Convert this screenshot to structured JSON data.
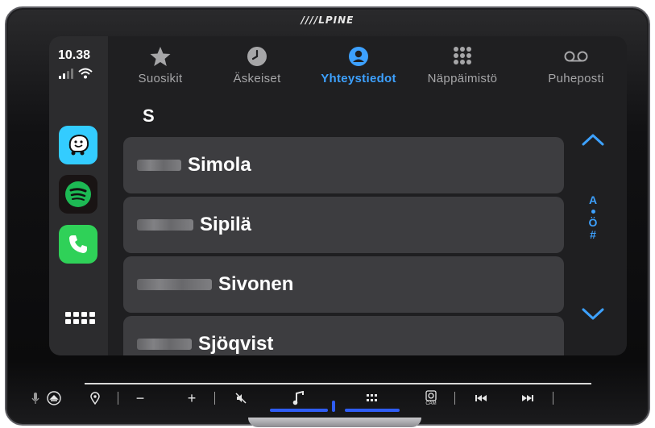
{
  "device": {
    "brand": "////LPINE"
  },
  "status": {
    "time": "10.38"
  },
  "apps": [
    {
      "name": "waze",
      "icon": "waze-icon",
      "color": "#33ccff"
    },
    {
      "name": "spotify",
      "icon": "spotify-icon",
      "color": "#1db954"
    },
    {
      "name": "phone",
      "icon": "phone-icon",
      "color": "#2fd158"
    }
  ],
  "tabs": [
    {
      "label": "Suosikit",
      "icon": "star-icon"
    },
    {
      "label": "Äskeiset",
      "icon": "clock-icon"
    },
    {
      "label": "Yhteystiedot",
      "icon": "person-circle-icon",
      "active": true
    },
    {
      "label": "Näppäimistö",
      "icon": "keypad-icon"
    },
    {
      "label": "Puheposti",
      "icon": "voicemail-icon"
    }
  ],
  "section_letter": "S",
  "contacts": [
    {
      "name": "Simola"
    },
    {
      "name": "Sipilä"
    },
    {
      "name": "Sivonen"
    },
    {
      "name": "Sjöqvist"
    }
  ],
  "index": {
    "top": "A",
    "middle": "Ö",
    "bottom": "#"
  },
  "hardkeys": {
    "minus": "−",
    "plus": "+",
    "cam": "CAM"
  },
  "colors": {
    "accent": "#3da1ff",
    "screen_bg": "#1f1f21",
    "cell_bg": "#3d3d40"
  }
}
